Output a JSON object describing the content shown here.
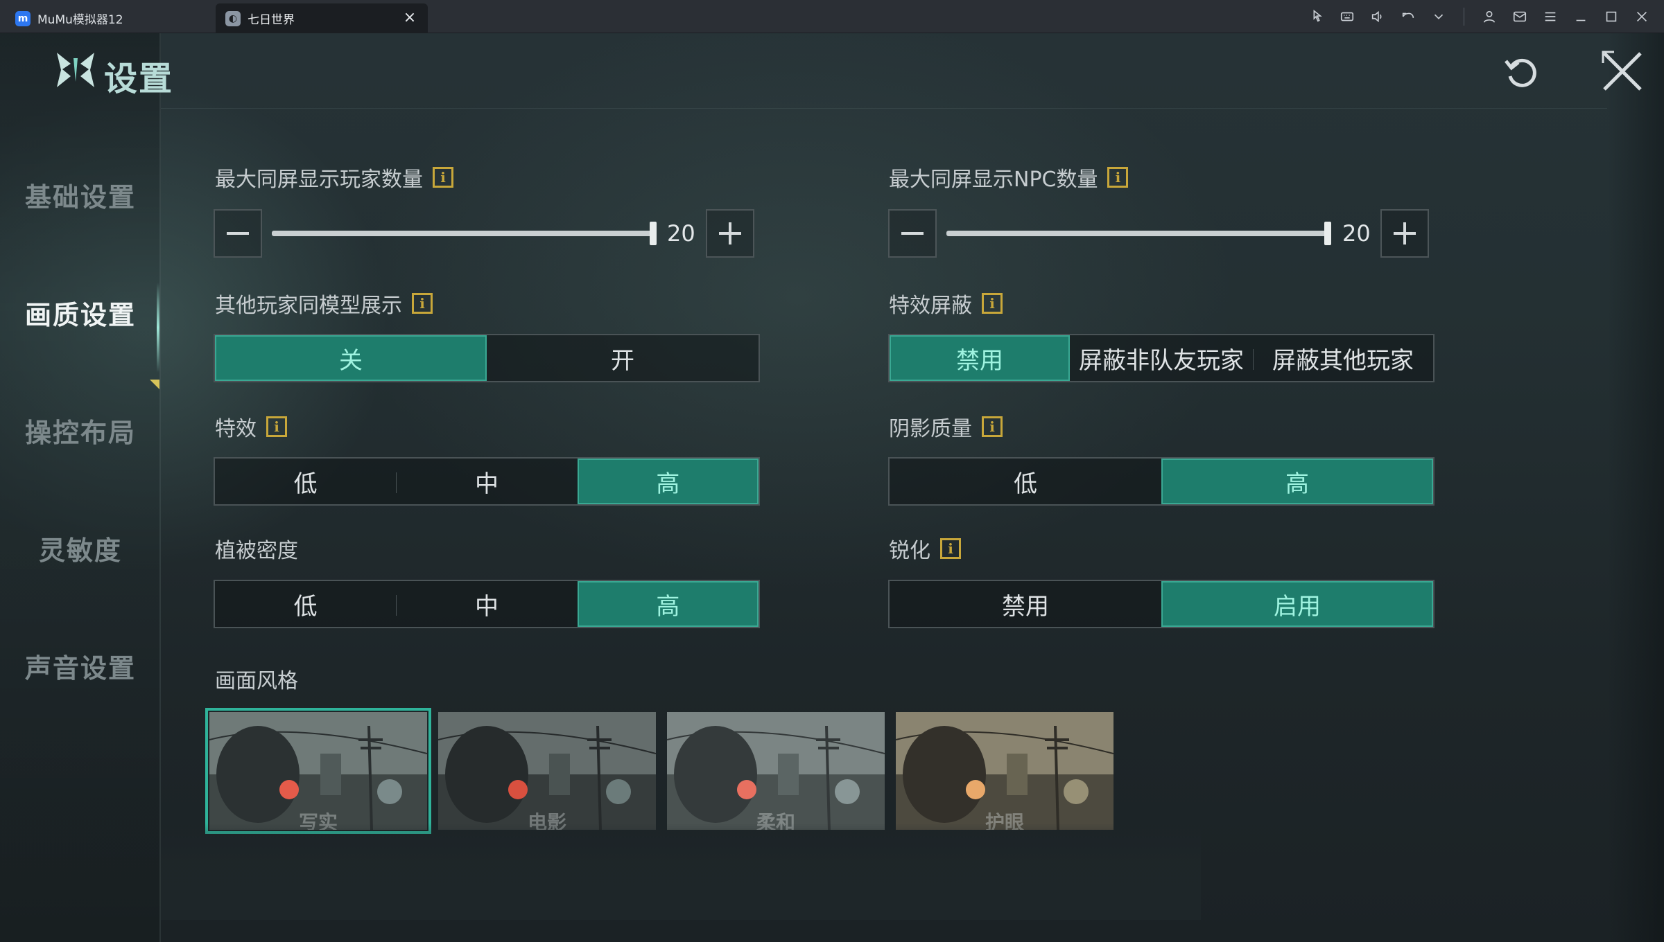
{
  "emulator": {
    "tabs": [
      {
        "title": "MuMu模拟器12",
        "icon": "mumu-logo-icon",
        "active": false
      },
      {
        "title": "七日世界",
        "icon": "game-icon",
        "active": true
      }
    ],
    "toolbar_icons": [
      "pointer-icon",
      "keyboard-icon",
      "volume-icon",
      "undo-icon",
      "chevron-down-icon",
      "user-icon",
      "mail-icon",
      "menu-icon",
      "minimize-icon",
      "maximize-icon",
      "close-icon"
    ]
  },
  "header": {
    "title": "设置"
  },
  "sidebar": {
    "items": [
      {
        "label": "基础设置",
        "active": false
      },
      {
        "label": "画质设置",
        "active": true
      },
      {
        "label": "操控布局",
        "active": false
      },
      {
        "label": "灵敏度",
        "active": false
      },
      {
        "label": "声音设置",
        "active": false
      }
    ]
  },
  "settings": {
    "max_players": {
      "label": "最大同屏显示玩家数量",
      "value": "20",
      "fraction": 1.0
    },
    "max_npc": {
      "label": "最大同屏显示NPC数量",
      "value": "20",
      "fraction": 1.0
    },
    "same_model": {
      "label": "其他玩家同模型展示",
      "options": [
        "关",
        "开"
      ],
      "selected": "关"
    },
    "effect_block": {
      "label": "特效屏蔽",
      "options": [
        "禁用",
        "屏蔽非队友玩家",
        "屏蔽其他玩家"
      ],
      "selected": "禁用"
    },
    "effects": {
      "label": "特效",
      "options": [
        "低",
        "中",
        "高"
      ],
      "selected": "高"
    },
    "shadow_quality": {
      "label": "阴影质量",
      "options": [
        "低",
        "高"
      ],
      "selected": "高"
    },
    "vegetation": {
      "label": "植被密度",
      "options": [
        "低",
        "中",
        "高"
      ],
      "selected": "高"
    },
    "sharpen": {
      "label": "锐化",
      "options": [
        "禁用",
        "启用"
      ],
      "selected": "启用"
    },
    "picture_style": {
      "label": "画面风格",
      "styles": [
        {
          "name": "写实",
          "selected": true
        },
        {
          "name": "电影",
          "selected": false
        },
        {
          "name": "柔和",
          "selected": false
        },
        {
          "name": "护眼",
          "selected": false
        }
      ]
    }
  },
  "colors": {
    "accent": "#1e7d6c",
    "accent_text": "#9ff3e0",
    "info_icon": "#c8a73a"
  }
}
